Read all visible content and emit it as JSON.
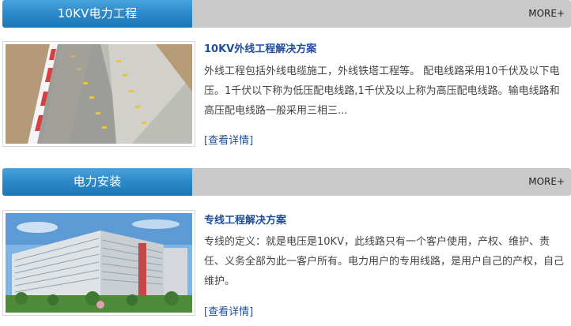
{
  "sections": [
    {
      "heading": "10KV电力工程",
      "more": "MORE+",
      "thumb_icon": "cable-trench-photo",
      "article_title": "10KV外线工程解决方案",
      "article_desc": "外线工程包括外线电缆施工，外线铁塔工程等。 配电线路采用10千伏及以下电压。1千伏以下称为低压配电线路,1千伏及以上称为高压配电线路。输电线路和高压配电线路一般采用三相三...",
      "detail": "[查看详情]"
    },
    {
      "heading": "电力安装",
      "more": "MORE+",
      "thumb_icon": "building-photo",
      "article_title": "专线工程解决方案",
      "article_desc": "专线的定义：就是电压是10KV，此线路只有一个客户使用，产权、维护、责任、义务全部为此一客户所有。电力用户的专用线路，是用户自己的产权，自己维护。",
      "detail": "[查看详情]"
    }
  ],
  "colors": {
    "tab_blue": "#2e8bcb",
    "header_gray": "#c9c9c9",
    "title_blue": "#1f4e9a"
  }
}
